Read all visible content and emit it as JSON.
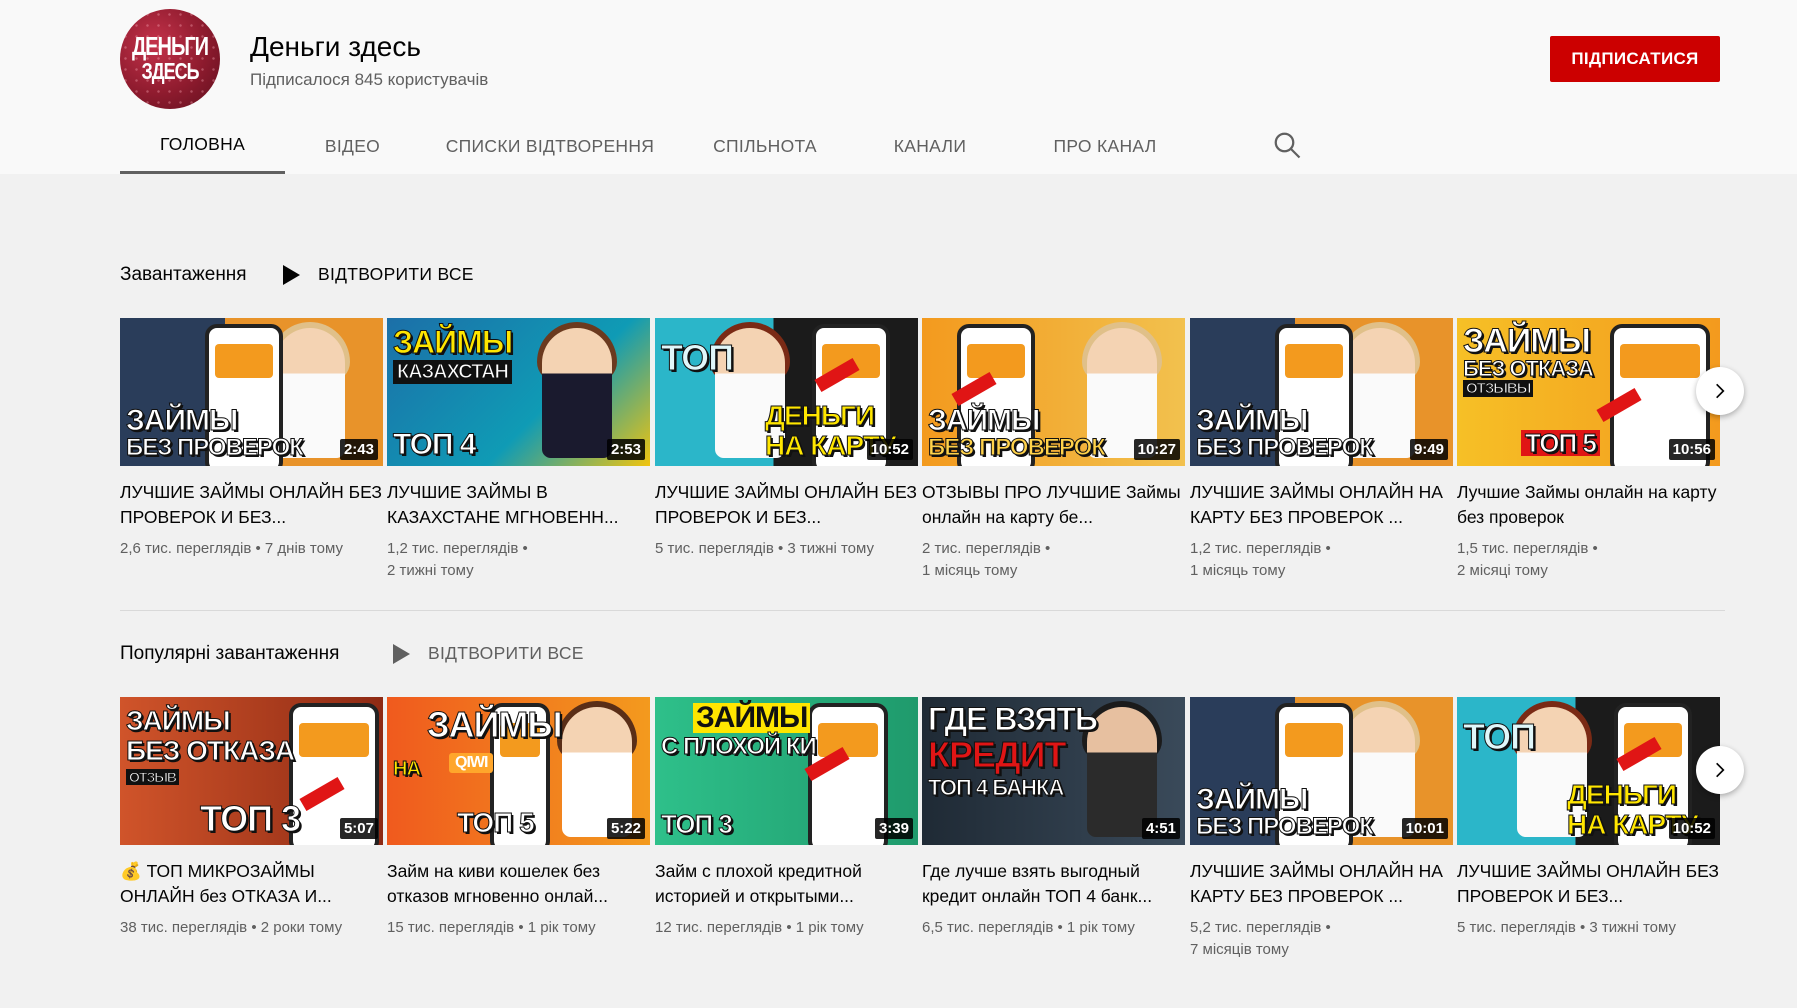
{
  "channel": {
    "avatar_line1": "ДЕНЬГИ",
    "avatar_line2": "ЗДЕСЬ",
    "name": "Деньги здесь",
    "subscribers": "Підписалося 845 користувачів",
    "subscribe_label": "ПІДПИСАТИСЯ",
    "accent_color": "#cc0000"
  },
  "tabs": [
    {
      "label": "ГОЛОВНА",
      "active": true
    },
    {
      "label": "ВІДЕО"
    },
    {
      "label": "СПИСКИ ВІДТВОРЕННЯ"
    },
    {
      "label": "СПІЛЬНОТА"
    },
    {
      "label": "КАНАЛИ"
    },
    {
      "label": "ПРО КАНАЛ"
    }
  ],
  "search_icon": "search-icon",
  "shelves": [
    {
      "title": "Завантаження",
      "play_all": "ВІДТВОРИТИ ВСЕ",
      "videos": [
        {
          "overlay1": "ЗАЙМЫ",
          "overlay2": "БЕЗ ПРОВЕРОК",
          "duration": "2:43",
          "title": "ЛУЧШИЕ ЗАЙМЫ ОНЛАЙН БЕЗ ПРОВЕРОК И БЕЗ...",
          "meta_line1": "2,6 тис. переглядів • 7 днів тому",
          "meta_line2": ""
        },
        {
          "overlay1": "ЗАЙМЫ",
          "overlay2": "КАЗАХСТАН",
          "overlay3": "ТОП 4",
          "duration": "2:53",
          "title": "ЛУЧШИЕ ЗАЙМЫ В КАЗАХСТАНЕ МГНОВЕНН...",
          "meta_line1": "1,2 тис. переглядів •",
          "meta_line2": "2 тижні тому"
        },
        {
          "overlay1": "ТОП",
          "overlay2": "ДЕНЬГИ",
          "overlay3": "НА КАРТУ",
          "duration": "10:52",
          "title": "ЛУЧШИЕ ЗАЙМЫ ОНЛАЙН БЕЗ ПРОВЕРОК И БЕЗ...",
          "meta_line1": "5 тис. переглядів • 3 тижні тому",
          "meta_line2": ""
        },
        {
          "overlay1": "ЗАЙМЫ",
          "overlay2": "БЕЗ ПРОВЕРОК",
          "duration": "10:27",
          "title": "ОТЗЫВЫ ПРО ЛУЧШИЕ Займы онлайн на карту бе...",
          "meta_line1": "2 тис. переглядів •",
          "meta_line2": "1 місяць тому"
        },
        {
          "overlay1": "ЗАЙМЫ",
          "overlay2": "БЕЗ ПРОВЕРОК",
          "duration": "9:49",
          "title": "ЛУЧШИЕ ЗАЙМЫ ОНЛАЙН НА КАРТУ БЕЗ ПРОВЕРОК ...",
          "meta_line1": "1,2 тис. переглядів •",
          "meta_line2": "1 місяць тому"
        },
        {
          "overlay1": "ЗАЙМЫ",
          "overlay2": "БЕЗ ОТКАЗА",
          "overlay3": "ТОП 5",
          "overlay4": "ОТЗЫВЫ",
          "duration": "10:56",
          "title": "Лучшие Займы онлайн на карту без проверок",
          "meta_line1": "1,5 тис. переглядів •",
          "meta_line2": "2 місяці тому"
        }
      ]
    },
    {
      "title": "Популярні завантаження",
      "play_all": "ВІДТВОРИТИ ВСЕ",
      "videos": [
        {
          "overlay1": "ЗАЙМЫ",
          "overlay2": "БЕЗ ОТКАЗА",
          "overlay3": "ТОП 3",
          "overlay4": "ОТЗЫВ",
          "duration": "5:07",
          "title": "💰 ТОП МИКРОЗАЙМЫ ОНЛАЙН без ОТКАЗА И...",
          "meta_line1": "38 тис. переглядів • 2 роки тому",
          "meta_line2": ""
        },
        {
          "overlay1": "ЗАЙМЫ",
          "overlay2": "НА",
          "overlay3": "ТОП 5",
          "overlay4": "QIWI",
          "duration": "5:22",
          "title": "Займ на киви кошелек без отказов мгновенно онлай...",
          "meta_line1": "15 тис. переглядів • 1 рік тому",
          "meta_line2": ""
        },
        {
          "overlay1": "ЗАЙМЫ",
          "overlay2": "С ПЛОХОЙ КИ",
          "overlay3": "ТОП 3",
          "duration": "3:39",
          "title": "Займ с плохой кредитной историей и открытыми...",
          "meta_line1": "12 тис. переглядів • 1 рік тому",
          "meta_line2": ""
        },
        {
          "overlay1": "ГДЕ ВЗЯТЬ",
          "overlay2": "КРЕДИТ",
          "overlay3": "ТОП 4 БАНКА",
          "duration": "4:51",
          "title": "Где лучше взять выгодный кредит онлайн ТОП 4 банк...",
          "meta_line1": "6,5 тис. переглядів • 1 рік тому",
          "meta_line2": ""
        },
        {
          "overlay1": "ЗАЙМЫ",
          "overlay2": "БЕЗ ПРОВЕРОК",
          "duration": "10:01",
          "title": "ЛУЧШИЕ ЗАЙМЫ ОНЛАЙН НА КАРТУ БЕЗ ПРОВЕРОК ...",
          "meta_line1": "5,2 тис. переглядів •",
          "meta_line2": "7 місяців тому"
        },
        {
          "overlay1": "ТОП",
          "overlay2": "ДЕНЬГИ",
          "overlay3": "НА КАРТУ",
          "duration": "10:52",
          "title": "ЛУЧШИЕ ЗАЙМЫ ОНЛАЙН БЕЗ ПРОВЕРОК И БЕЗ...",
          "meta_line1": "5 тис. переглядів • 3 тижні тому",
          "meta_line2": ""
        }
      ]
    }
  ]
}
